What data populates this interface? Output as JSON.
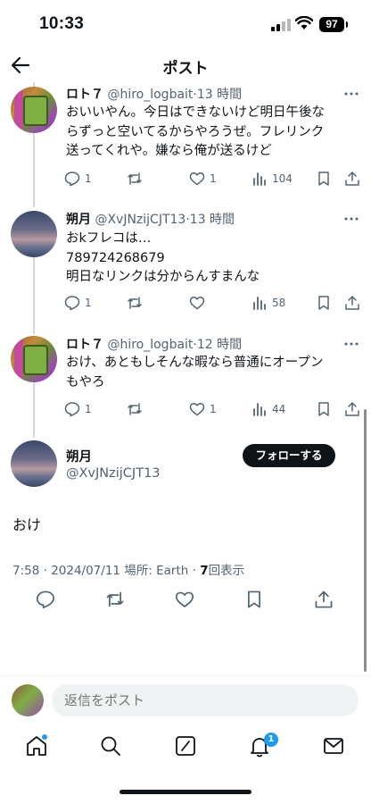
{
  "status_bar": {
    "time": "10:33",
    "battery": "97"
  },
  "header": {
    "title": "ポスト"
  },
  "tweets": [
    {
      "name": "ロト７",
      "handle": "@hiro_logbait",
      "time": "·13 時間",
      "body": "おいいやん。今日はできないけど明日午後な\nらずっと空いてるからやろうぜ。フレリンク\n送ってくれや。嫌なら俺が送るけど",
      "replies": "1",
      "reposts": "",
      "likes": "1",
      "views": "104"
    },
    {
      "name": "朔月",
      "handle": "@XvJNzijCJT13",
      "time": "·13 時間",
      "body": "おkフレコは…\n789724268679\n明日なリンクは分からんすまんな",
      "replies": "1",
      "reposts": "",
      "likes": "",
      "views": "58"
    },
    {
      "name": "ロト７",
      "handle": "@hiro_logbait",
      "time": "·12 時間",
      "body": "おけ、あともしそんな暇なら普通にオープン\nもやろ",
      "replies": "1",
      "reposts": "",
      "likes": "1",
      "views": "44"
    }
  ],
  "main_tweet": {
    "name": "朔月",
    "handle": "@XvJNzijCJT13",
    "follow_label": "フォローする",
    "text": "おけ",
    "meta_prefix": "7:58 · 2024/07/11 場所: Earth · ",
    "views_count": "7",
    "views_label": "回表示"
  },
  "reply_bar": {
    "placeholder": "返信をポスト"
  },
  "bottom_nav": {
    "notifications_badge": "1"
  },
  "colors": {
    "accent": "#1d9bf0",
    "text": "#0f1419",
    "muted": "#536471",
    "line": "#cfd9de"
  },
  "icons": [
    "back-arrow-icon",
    "more-icon",
    "reply-icon",
    "repost-icon",
    "like-icon",
    "views-icon",
    "bookmark-icon",
    "share-icon",
    "home-icon",
    "search-icon",
    "grok-icon",
    "bell-icon",
    "mail-icon"
  ]
}
